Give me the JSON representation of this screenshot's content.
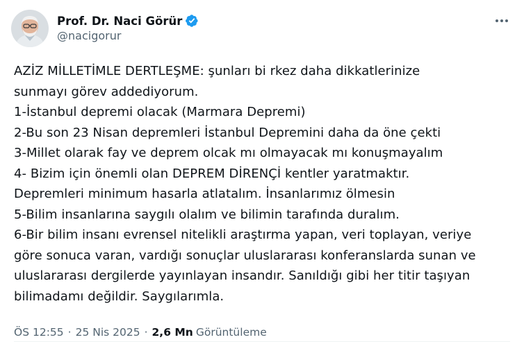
{
  "author": {
    "display_name": "Prof. Dr. Naci Görür",
    "handle": "@nacigorur",
    "verified_icon": "verified-badge-icon",
    "verified_color": "#1d9bf0"
  },
  "more_icon": "more-horizontal-icon",
  "tweet": {
    "lines": [
      "AZİZ MİLLETİMLE DERTLEŞME: şunları bi rkez daha dikkatlerinize",
      "sunmayı görev addediyorum.",
      "1-İstanbul depremi olacak (Marmara Depremi)",
      "2-Bu son 23 Nisan depremleri İstanbul Depremini daha da öne çekti",
      "3-Millet olarak fay ve deprem olcak mı olmayacak mı konuşmayalım",
      "4- Bizim için önemli olan DEPREM DİRENÇİ kentler yaratmaktır.",
      "Depremleri minimum hasarla atlatalım. İnsanlarımız ölmesin",
      "5-Bilim insanlarına saygılı olalım ve bilimin tarafında duralım.",
      "6-Bir bilim insanı evrensel nitelikli araştırma yapan, veri toplayan, veriye",
      "göre sonuca varan, vardığı sonuçlar uluslararası konferanslarda sunan ve",
      "uluslararası dergilerde yayınlayan insandır. Sanıldığı gibi her titir taşıyan",
      "bilimadamı değildir. Saygılarımla."
    ]
  },
  "meta": {
    "time": "ÖS 12:55",
    "separator": "·",
    "date": "25 Nis 2025",
    "views_count": "2,6 Mn",
    "views_label": "Görüntüleme"
  }
}
